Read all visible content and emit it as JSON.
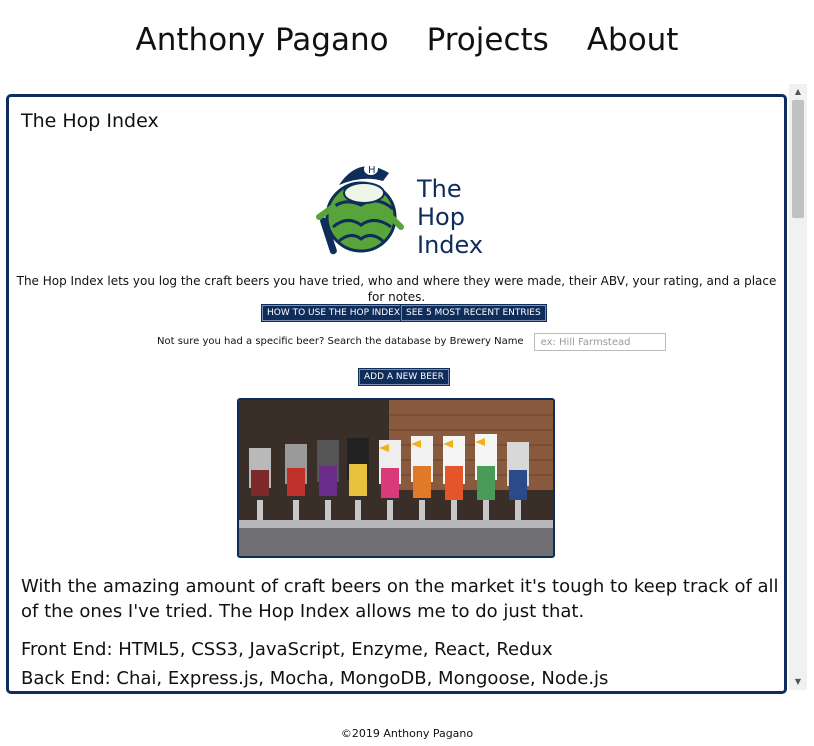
{
  "nav": {
    "items": [
      "Anthony Pagano",
      "Projects",
      "About"
    ]
  },
  "project": {
    "title": "The Hop Index",
    "logo_text": "The\nHop\nIndex",
    "intro": "The Hop Index lets you log the craft beers you have tried, who and where they were made, their ABV, your rating, and a place for notes.",
    "buttons": {
      "how_to": "HOW TO USE THE HOP INDEX",
      "recent": "SEE 5 MOST RECENT ENTRIES",
      "add": "ADD A NEW BEER"
    },
    "search": {
      "label": "Not sure you had a specific beer? Search the database by Brewery Name",
      "placeholder": "ex: Hill Farmstead"
    },
    "description": "With the amazing amount of craft beers on the market it's tough to keep track of all of the ones I've tried. The Hop Index allows me to do just that.",
    "front_end": "Front End: HTML5, CSS3, JavaScript, Enzyme, React, Redux",
    "back_end": "Back End: Chai, Express.js, Mocha, MongoDB, Mongoose, Node.js"
  },
  "footer": {
    "copyright": "©2019 Anthony Pagano"
  },
  "colors": {
    "accent": "#0f2d5a",
    "hop_green": "#58a43a"
  },
  "icons": {
    "scroll_up": "scroll-up-arrow-icon",
    "scroll_down": "scroll-down-arrow-icon"
  }
}
